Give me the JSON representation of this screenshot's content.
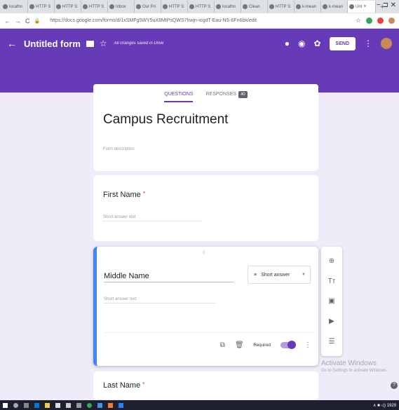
{
  "browser": {
    "tabs": [
      {
        "label": "localho"
      },
      {
        "label": "HTTP S"
      },
      {
        "label": "HTTP S"
      },
      {
        "label": "HTTP S"
      },
      {
        "label": "Inbox"
      },
      {
        "label": "Our Pri"
      },
      {
        "label": "HTTP S"
      },
      {
        "label": "HTTP S"
      },
      {
        "label": "localho"
      },
      {
        "label": "Clean"
      },
      {
        "label": "HTTP S"
      },
      {
        "label": "k-mean"
      },
      {
        "label": "k-mean"
      },
      {
        "label": "Unt"
      }
    ],
    "new_tab": "+",
    "window_controls": "−  ⊐  ✕",
    "url": "https://docs.google.com/forms/d/1xSMFg5WY5uX8MtPsQWS7hwjn-iogdT-Eau-NS-6Fn6bk/edit"
  },
  "header": {
    "title": "Untitled form",
    "saved_text": "All changes saved in Drive",
    "send_label": "SEND"
  },
  "tabs": {
    "questions": "QUESTIONS",
    "responses": "RESPONSES",
    "responses_count": "40"
  },
  "form": {
    "title": "Campus Recruitment",
    "description_placeholder": "Form description"
  },
  "questions": [
    {
      "title": "First Name",
      "required_mark": "*",
      "placeholder": "Short answer text"
    },
    {
      "title": "Middle Name",
      "type": "Short answer",
      "placeholder": "Short answer text",
      "required_label": "Required"
    },
    {
      "title": "Last Name",
      "required_mark": "*"
    }
  ],
  "watermark": {
    "line1": "Activate Windows",
    "line2": "Go to Settings to activate Windows."
  },
  "taskbar": {
    "clock": "∧ ■ ◁)  1929"
  },
  "colors": {
    "accent": "#673ab7",
    "background": "#f0ebf8",
    "active_border": "#4285f4"
  }
}
